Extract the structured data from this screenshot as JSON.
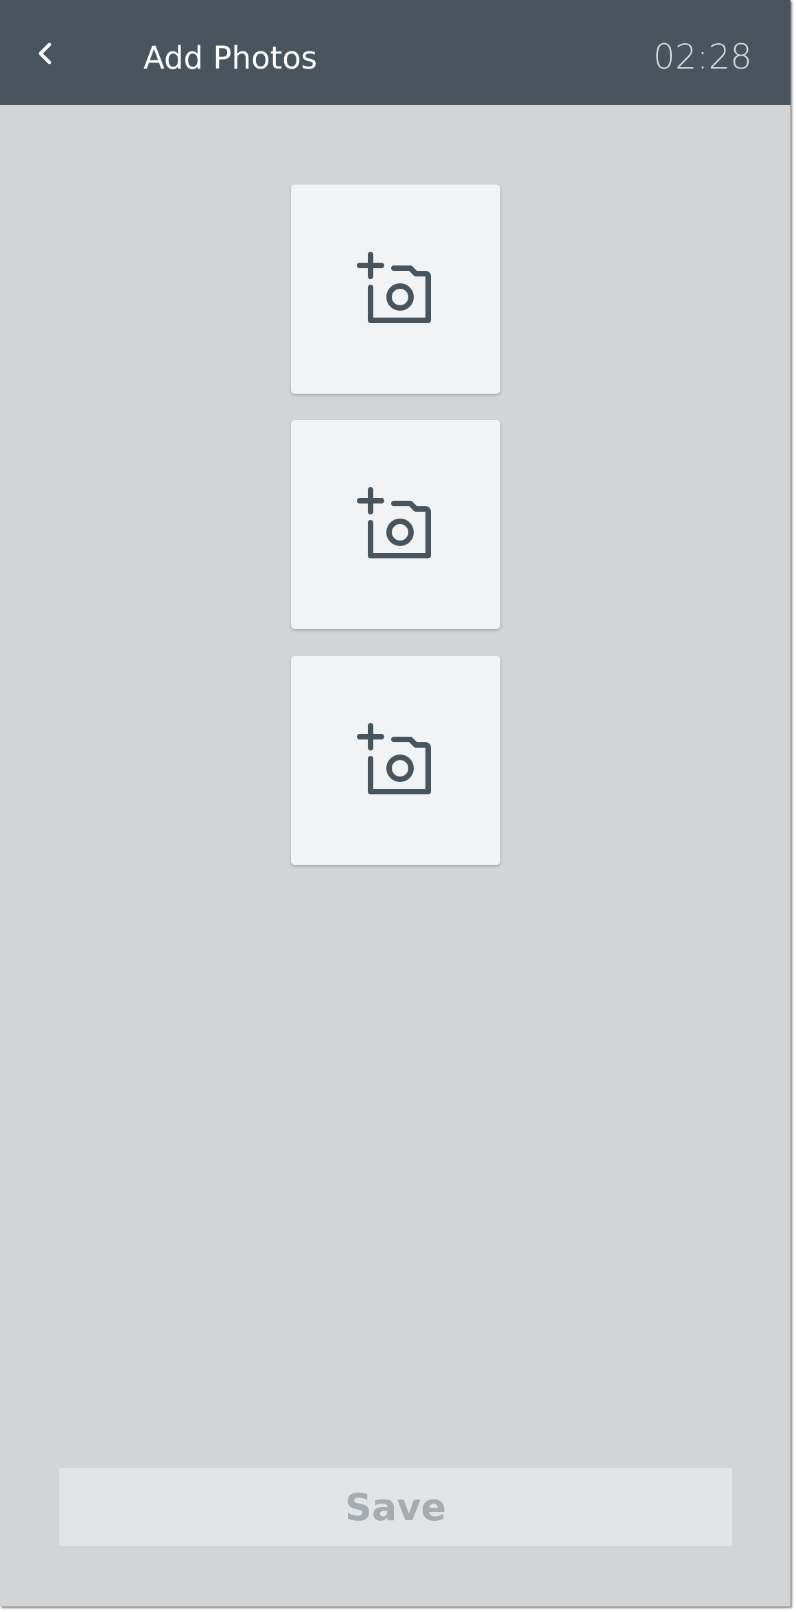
{
  "header": {
    "title": "Add Photos",
    "timer": "02:28",
    "back_icon": "chevron-left-icon"
  },
  "photo_slots": [
    {
      "icon": "add-photo-icon"
    },
    {
      "icon": "add-photo-icon"
    },
    {
      "icon": "add-photo-icon"
    }
  ],
  "footer": {
    "save_label": "Save",
    "save_disabled": true
  },
  "colors": {
    "app_bar": "#4a545d",
    "background": "#d3d4d6",
    "card": "#f2f3f5",
    "icon": "#4a545d",
    "save_bg": "#e2e3e5",
    "save_text": "#a5abaf"
  }
}
